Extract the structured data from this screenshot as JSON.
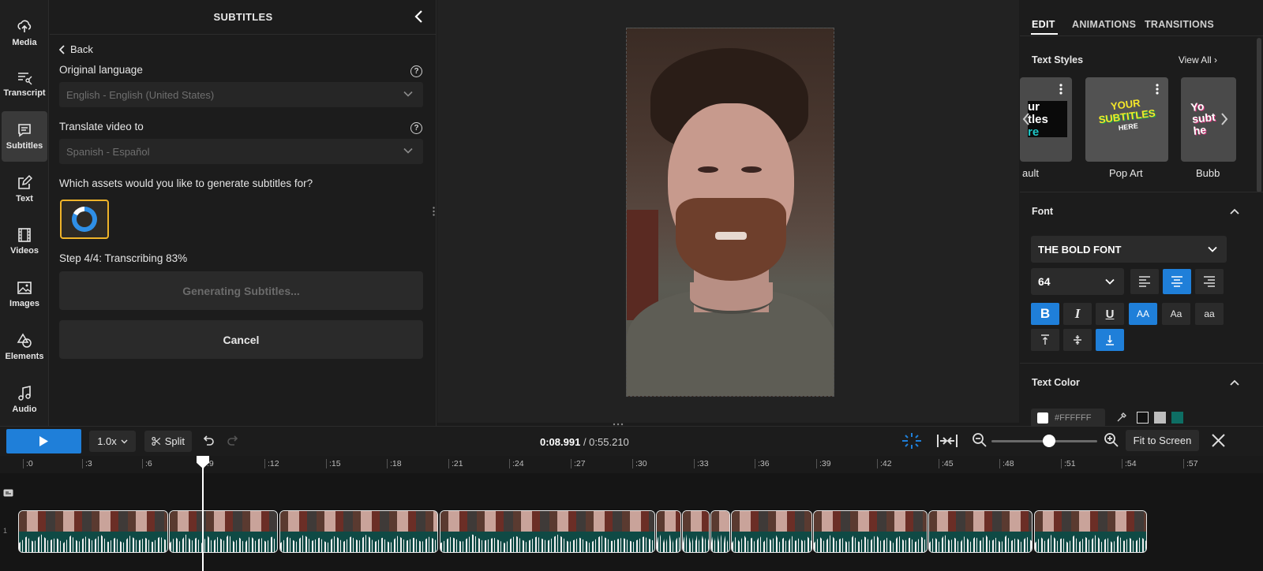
{
  "rail": {
    "items": [
      {
        "label": "Media",
        "icon": "upload-icon"
      },
      {
        "label": "Transcript",
        "icon": "transcript-icon"
      },
      {
        "label": "Subtitles",
        "icon": "subtitles-icon"
      },
      {
        "label": "Text",
        "icon": "text-edit-icon"
      },
      {
        "label": "Videos",
        "icon": "film-icon"
      },
      {
        "label": "Images",
        "icon": "image-icon"
      },
      {
        "label": "Elements",
        "icon": "shapes-icon"
      },
      {
        "label": "Audio",
        "icon": "music-note-icon"
      }
    ],
    "active": "Subtitles"
  },
  "subtitles_panel": {
    "title": "SUBTITLES",
    "back_label": "Back",
    "original_language_label": "Original language",
    "original_language_value": "English - English (United States)",
    "translate_label": "Translate video to",
    "translate_value": "Spanish - Español",
    "assets_question": "Which assets would you like to generate subtitles for?",
    "step_status": "Step 4/4: Transcribing 83%",
    "progress_fraction": 0.83,
    "generate_button": "Generating Subtitles...",
    "cancel_button": "Cancel"
  },
  "properties": {
    "tabs": [
      "EDIT",
      "ANIMATIONS",
      "TRANSITIONS"
    ],
    "active_tab": "EDIT",
    "text_styles_title": "Text Styles",
    "view_all": "View All",
    "styles": [
      {
        "name": "ault",
        "preview_lines": [
          "ur",
          "tles",
          "re"
        ]
      },
      {
        "name": "Pop Art",
        "preview_lines": [
          "YOUR",
          "SUBTITLES",
          "HERE"
        ]
      },
      {
        "name": "Bubb",
        "preview_lines": [
          "Yo",
          "subt",
          "he"
        ]
      }
    ],
    "font_title": "Font",
    "font_value": "THE BOLD FONT",
    "font_size": "64",
    "case_aa_upper": "AA",
    "case_aa_title": "Aa",
    "case_aa_lower": "aa",
    "text_color_title": "Text Color",
    "text_color_value": "#FFFFFF"
  },
  "toolbar": {
    "speed": "1.0x",
    "split_label": "Split",
    "current_time": "0:08.991",
    "separator": " / ",
    "total_time": "0:55.210",
    "fit_label": "Fit to Screen",
    "zoom_level": 0.5
  },
  "timeline": {
    "ticks": [
      ":0",
      ":3",
      ":6",
      ":9",
      ":12",
      ":15",
      ":18",
      ":21",
      ":24",
      ":27",
      ":30",
      ":33",
      ":36",
      ":39",
      ":42",
      ":45",
      ":48",
      ":51",
      ":54",
      ":57"
    ],
    "track_number": "1"
  },
  "colors": {
    "accent": "#1f7fd9",
    "highlight": "#f0b429",
    "background": "#1b1b1b"
  }
}
